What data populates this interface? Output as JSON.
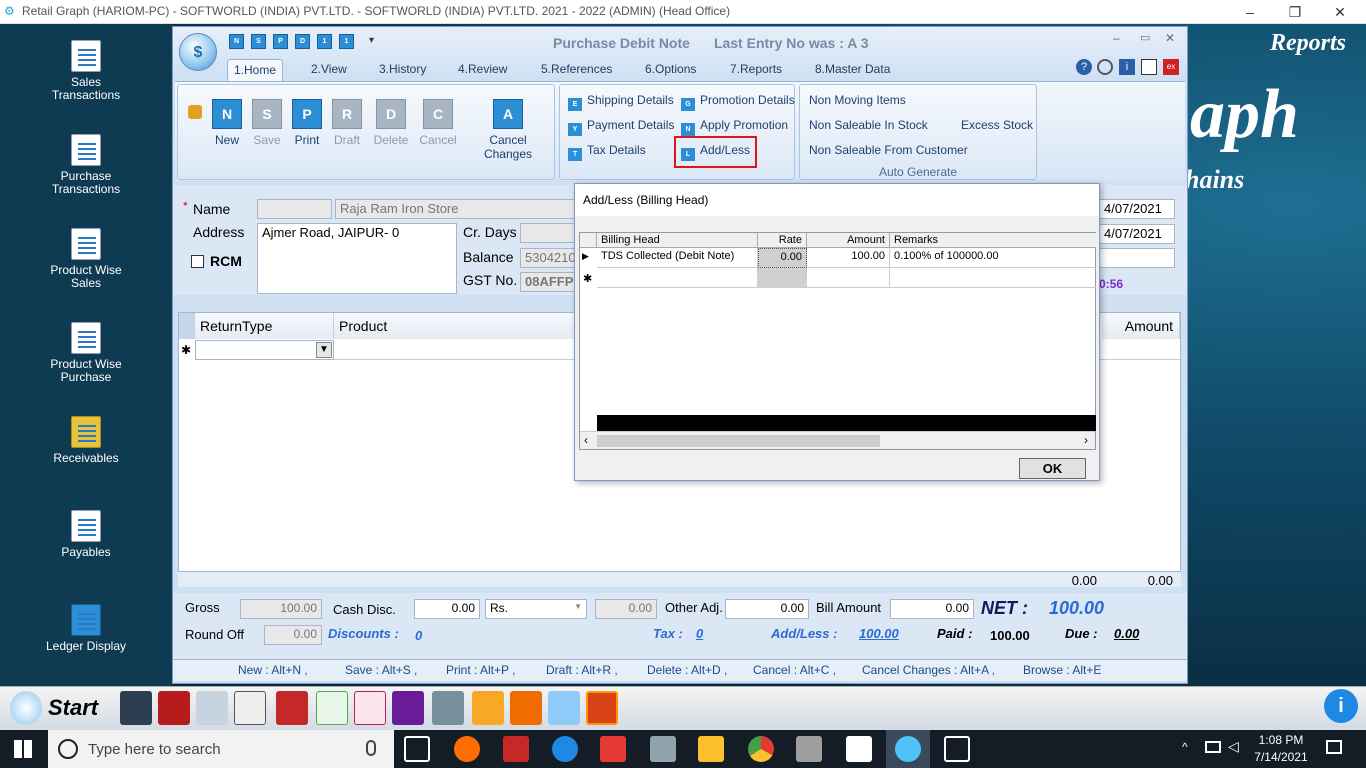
{
  "window": {
    "title": "Retail Graph (HARIOM-PC) - SOFTWORLD (INDIA) PVT.LTD. - SOFTWORLD (INDIA) PVT.LTD.  2021 - 2022 (ADMIN) (Head Office)"
  },
  "desktop": {
    "brand": "Reports",
    "graph_text": "aph",
    "chains_text": "hains"
  },
  "sidebar": {
    "items": [
      {
        "label": "Sales Transactions"
      },
      {
        "label": "Purchase Transactions"
      },
      {
        "label": "Product Wise Sales"
      },
      {
        "label": "Product Wise Purchase"
      },
      {
        "label": "Receivables"
      },
      {
        "label": "Payables"
      },
      {
        "label": "Ledger Display"
      }
    ]
  },
  "app": {
    "title": "Purchase Debit Note",
    "last_entry": "Last Entry No was : A 3",
    "qat": [
      "N",
      "S",
      "P",
      "D",
      "1",
      "1"
    ],
    "tabs": [
      "1.Home",
      "2.View",
      "3.History",
      "4.Review",
      "5.References",
      "6.Options",
      "7.Reports",
      "8.Master Data"
    ],
    "buttons": {
      "new": "New",
      "save": "Save",
      "print": "Print",
      "draft": "Draft",
      "delete": "Delete",
      "cancel": "Cancel",
      "cancel_changes": "Cancel Changes"
    },
    "links": {
      "shipping": "Shipping Details",
      "payment": "Payment Details",
      "tax": "Tax Details",
      "promotion": "Promotion Details",
      "apply_promo": "Apply Promotion",
      "addless": "Add/Less"
    },
    "auto": {
      "non_moving": "Non Moving Items",
      "non_saleable_stock": "Non Saleable In Stock",
      "excess_stock": "Excess Stock",
      "non_saleable_customer": "Non Saleable From Customer",
      "group_label": "Auto Generate"
    }
  },
  "form": {
    "name_label": "Name",
    "name_value": "Raja Ram Iron Store",
    "address_label": "Address",
    "address_value": "Ajmer Road, JAIPUR- 0",
    "rcm_label": "RCM",
    "cr_days_label": "Cr. Days",
    "balance_label": "Balance",
    "balance_value": "5304210.",
    "gst_label": "GST No.",
    "gst_value": "08AFFPN",
    "date1": "4/07/2021",
    "date2": "4/07/2021",
    "time": "0:56"
  },
  "grid": {
    "headers": [
      "ReturnType",
      "Product",
      "Amount"
    ],
    "totals": [
      "0.00",
      "0.00"
    ]
  },
  "bottom": {
    "gross_label": "Gross",
    "gross_value": "100.00",
    "cash_disc_label": "Cash Disc.",
    "cash_disc_value": "0.00",
    "rs_select": "Rs.",
    "disc_pct": "0.00",
    "other_adj_label": "Other Adj.",
    "other_adj_value": "0.00",
    "bill_amount_label": "Bill Amount",
    "bill_amount_value": "0.00",
    "net_label": "NET :",
    "net_value": "100.00",
    "round_off_label": "Round Off",
    "round_off_value": "0.00",
    "discounts_label": "Discounts :",
    "discounts_value": "0",
    "tax_label": "Tax :",
    "tax_value": "0",
    "addless_label": "Add/Less :",
    "addless_value": "100.00",
    "paid_label": "Paid :",
    "paid_value": "100.00",
    "due_label": "Due :",
    "due_value": "0.00"
  },
  "shortcuts": [
    "New : Alt+N ,",
    "Save : Alt+S ,",
    "Print : Alt+P ,",
    "Draft : Alt+R ,",
    "Delete : Alt+D ,",
    "Cancel : Alt+C ,",
    "Cancel Changes : Alt+A ,",
    "Browse : Alt+E"
  ],
  "dialog": {
    "title": "Add/Less (Billing Head)",
    "headers": [
      "Billing Head",
      "Rate",
      "Amount",
      "Remarks"
    ],
    "rows": [
      {
        "head": "TDS Collected (Debit Note)",
        "rate": "0.00",
        "amount": "100.00",
        "remarks": "0.100% of 100000.00"
      }
    ],
    "ok": "OK"
  },
  "appbar": {
    "start": "Start"
  },
  "taskbar": {
    "search_placeholder": "Type here to search",
    "time": "1:08 PM",
    "date": "7/14/2021"
  }
}
